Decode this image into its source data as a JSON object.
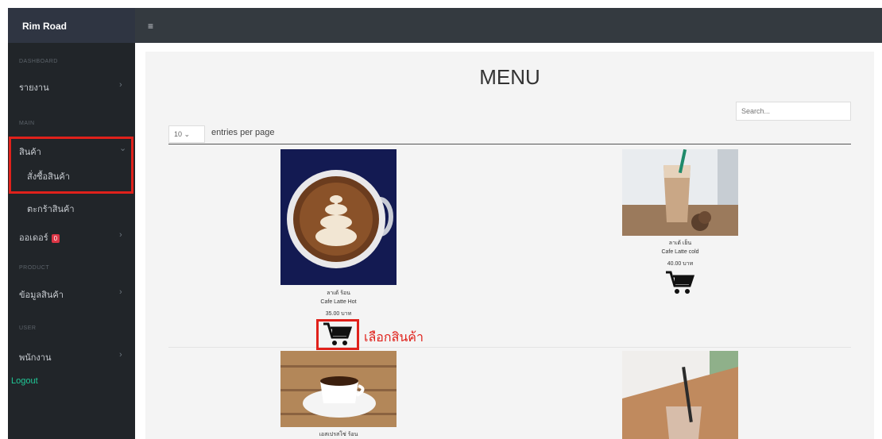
{
  "header": {
    "brand": "Rim Road",
    "menu_icon": "≡"
  },
  "sidebar": {
    "heading_1": "DASHBOARD",
    "item_report": "รายงาน",
    "heading_2": "MAIN",
    "item_products": "สินค้า",
    "sub_order": "สั่งซื้อสินค้า",
    "sub_cart": "ตะกร้าสินค้า",
    "item_orders": "ออเดอร์",
    "orders_badge": "0",
    "heading_3": "PRODUCT",
    "item_product_data": "ข้อมูลสินค้า",
    "heading_4": "USER",
    "item_employee": "พนักงาน",
    "logout": "Logout"
  },
  "main": {
    "title": "MENU",
    "entries_value": "10",
    "entries_label": "entries per page",
    "search_placeholder": "Search..."
  },
  "products": [
    {
      "name": "ลาเต้ ร้อน",
      "desc": "Cafe Latte Hot",
      "price": "35.00 บาท"
    },
    {
      "name": "ลาเต้ เย็น",
      "desc": "Cafe Latte cold",
      "price": "40.00 บาท"
    },
    {
      "name": "เอสเปรสโซ่ ร้อน"
    }
  ],
  "annotation": "เลือกสินค้า",
  "icons": {
    "cart": "cart-icon",
    "chevron": "chevron-right-icon"
  },
  "colors": {
    "highlight": "#e0211b",
    "sidebar": "#212529",
    "logout": "#20c997"
  }
}
